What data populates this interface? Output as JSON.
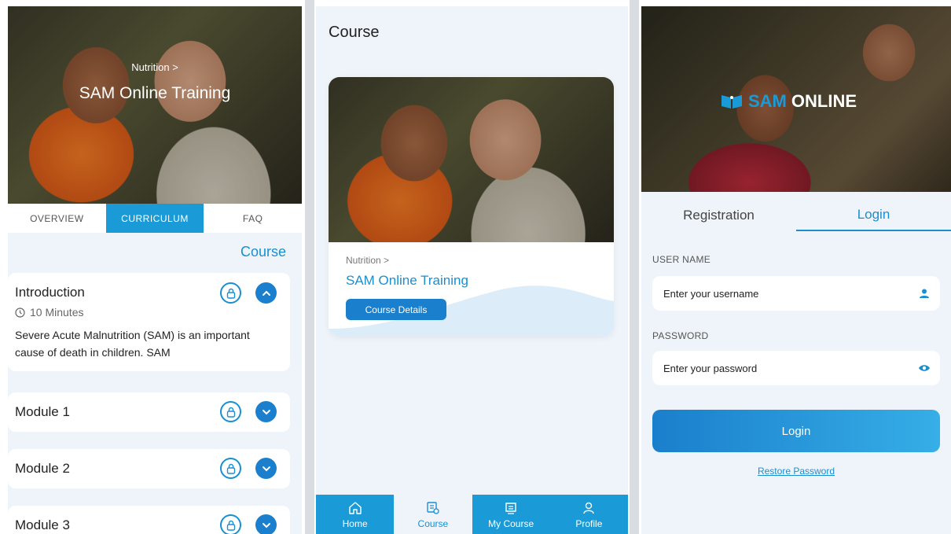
{
  "curriculum_screen": {
    "hero": {
      "breadcrumb": "Nutrition >",
      "title": "SAM Online Training"
    },
    "tabs": [
      "OVERVIEW",
      "CURRICULUM",
      "FAQ"
    ],
    "active_tab": "CURRICULUM",
    "course_link": "Course",
    "intro": {
      "title": "Introduction",
      "duration": "10 Minutes",
      "description": "Severe Acute Malnutrition (SAM) is an important cause of death in children. SAM"
    },
    "modules": [
      {
        "title": "Module 1"
      },
      {
        "title": "Module 2"
      },
      {
        "title": "Module 3"
      }
    ]
  },
  "course_screen": {
    "heading": "Course",
    "card": {
      "breadcrumb": "Nutrition >",
      "title": "SAM Online Training",
      "button": "Course Details"
    },
    "nav": [
      {
        "label": "Home",
        "icon": "home-icon"
      },
      {
        "label": "Course",
        "icon": "course-icon"
      },
      {
        "label": "My Course",
        "icon": "my-course-icon"
      },
      {
        "label": "Profile",
        "icon": "profile-icon"
      }
    ],
    "active_nav": "Course"
  },
  "login_screen": {
    "brand": {
      "part1": "SAM",
      "part2": "ONLINE"
    },
    "tabs": [
      "Registration",
      "Login"
    ],
    "active_tab": "Login",
    "username": {
      "label": "USER NAME",
      "placeholder": "Enter your username"
    },
    "password": {
      "label": "PASSWORD",
      "placeholder": "Enter your password"
    },
    "login_button": "Login",
    "restore_link": "Restore Password"
  },
  "colors": {
    "primary": "#1a8fd0",
    "tab_active": "#1a9ad6",
    "background": "#eef4fa"
  }
}
